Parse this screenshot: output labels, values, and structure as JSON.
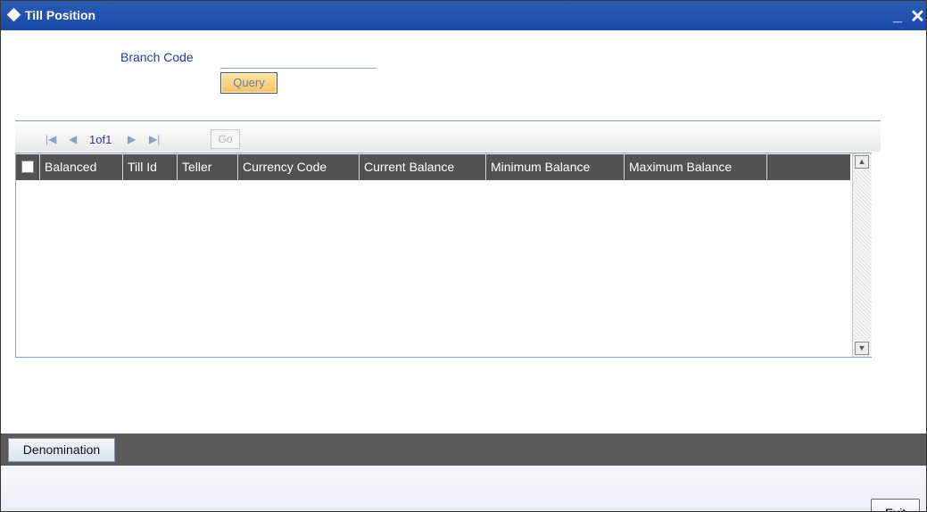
{
  "window": {
    "title": "Till Position",
    "minimize_glyph": "_",
    "close_glyph": "✕"
  },
  "form": {
    "branch_code_label": "Branch Code",
    "branch_code_value": "",
    "query_button": "Query"
  },
  "pager": {
    "first_icon": "first-page-icon",
    "prev_icon": "prev-page-icon",
    "next_icon": "next-page-icon",
    "last_icon": "last-page-icon",
    "first_glyph": "|◀",
    "prev_glyph": "◀",
    "next_glyph": "▶",
    "last_glyph": "▶|",
    "page_text": "1of1",
    "go_button": "Go"
  },
  "grid": {
    "columns": [
      "Balanced",
      "Till Id",
      "Teller",
      "Currency Code",
      "Current Balance",
      "Minimum Balance",
      "Maximum Balance"
    ],
    "rows": [],
    "scroll_up_glyph": "▲",
    "scroll_down_glyph": "▼"
  },
  "bottom_bar": {
    "denomination_button": "Denomination"
  },
  "footer": {
    "exit_button": "Exit"
  },
  "colors": {
    "titlebar": "#1a4aa7",
    "label_text": "#2d3a9c",
    "grid_header": "#525252",
    "bottom_bar": "#5a5a5a"
  }
}
